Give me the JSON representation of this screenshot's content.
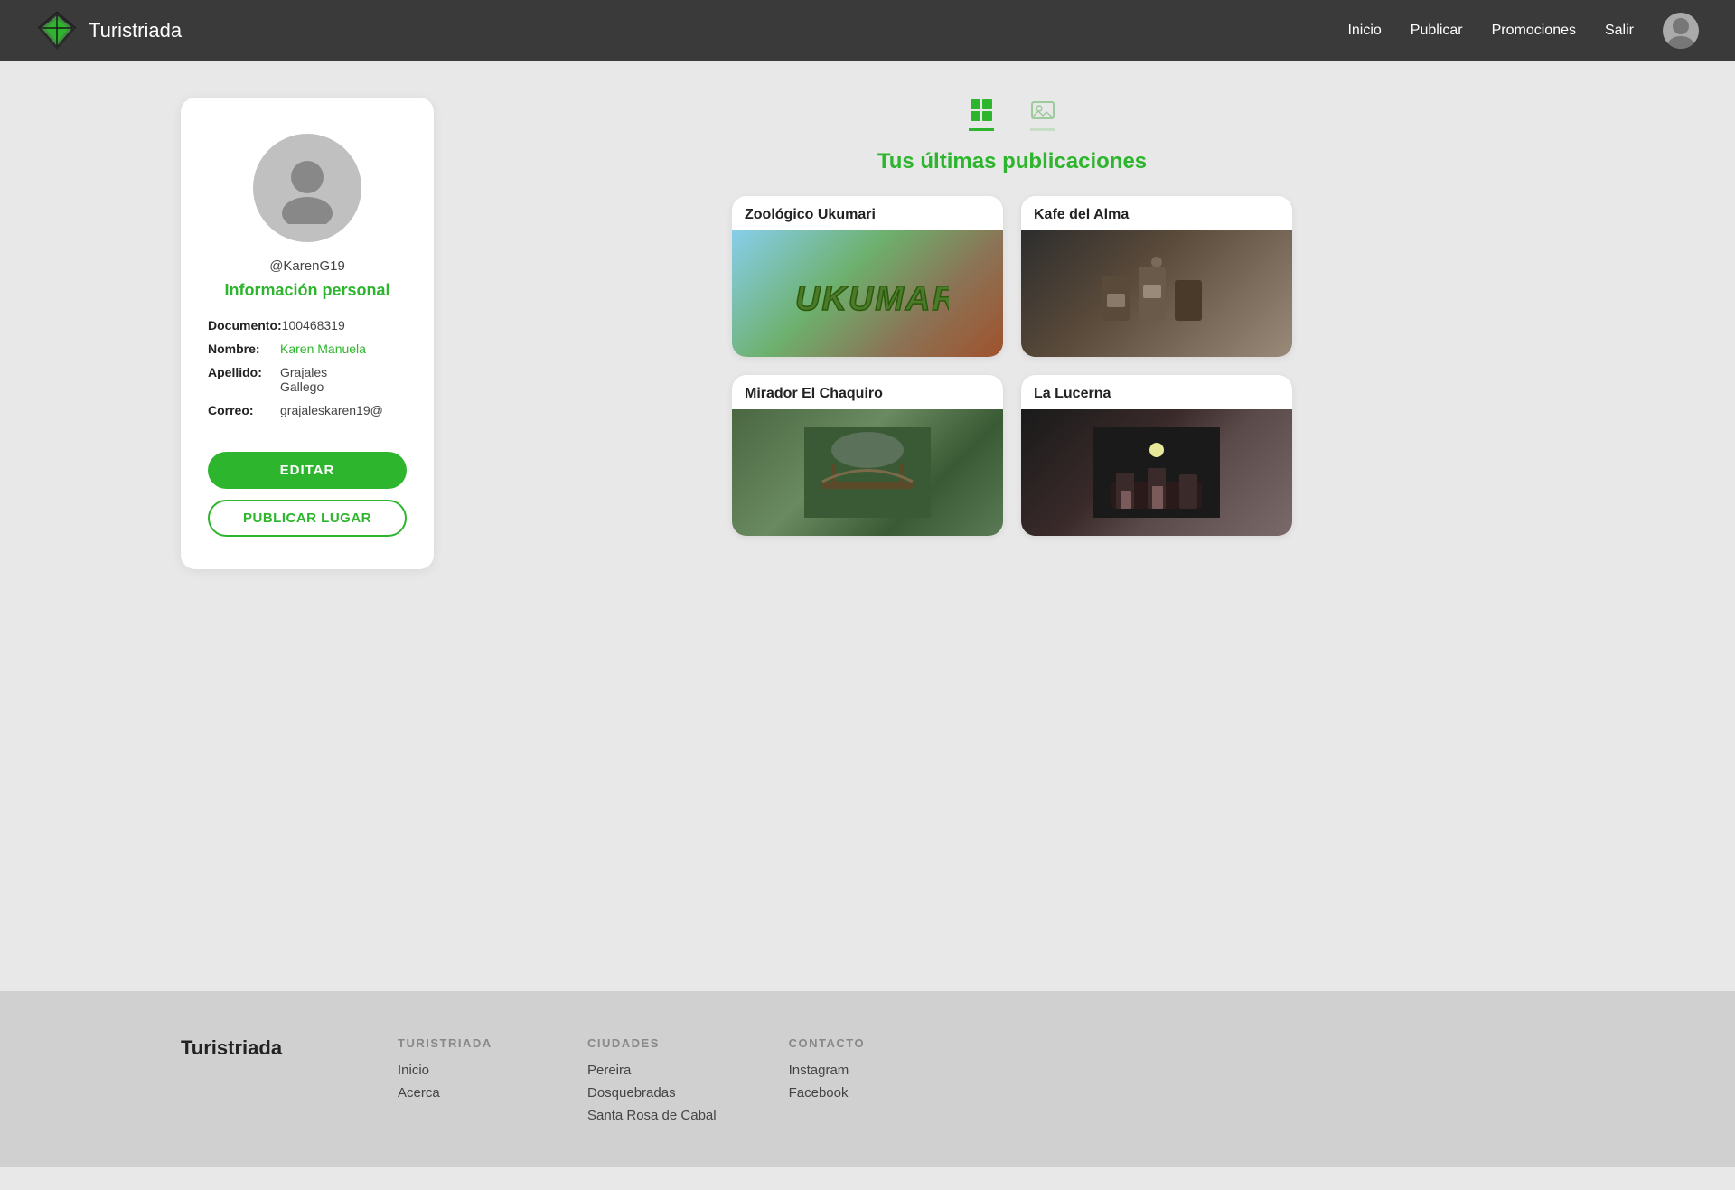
{
  "navbar": {
    "title": "Turistriada",
    "links": [
      "Inicio",
      "Publicar",
      "Promociones",
      "Salir"
    ]
  },
  "profile": {
    "username": "@KarenG19",
    "info_title": "Información personal",
    "doc_label": "Documento:",
    "doc_value": "100468319",
    "name_label": "Nombre:",
    "name_value": "Karen Manuela",
    "lastname_label": "Apellido:",
    "lastname_value": "Grajales\nGallego",
    "email_label": "Correo:",
    "email_value": "grajaleskaren19@",
    "edit_button": "EDITAR",
    "publish_button": "PUBLICAR LUGAR"
  },
  "publications": {
    "section_title": "Tus últimas publicaciones",
    "cards": [
      {
        "id": "ukumari",
        "title": "Zoológico Ukumari",
        "img_class": "img-ukumari"
      },
      {
        "id": "kafe",
        "title": "Kafe del Alma",
        "img_class": "img-kafe"
      },
      {
        "id": "mirador",
        "title": "Mirador El Chaquiro",
        "img_class": "img-mirador"
      },
      {
        "id": "lucerna",
        "title": "La Lucerna",
        "img_class": "img-lucerna"
      }
    ]
  },
  "footer": {
    "brand": "Turistriada",
    "col1": {
      "title": "TURISTRIADA",
      "links": [
        "Inicio",
        "Acerca"
      ]
    },
    "col2": {
      "title": "CIUDADES",
      "links": [
        "Pereira",
        "Dosquebradas",
        "Santa Rosa de Cabal"
      ]
    },
    "col3": {
      "title": "CONTACTO",
      "links": [
        "Instagram",
        "Facebook"
      ]
    }
  }
}
